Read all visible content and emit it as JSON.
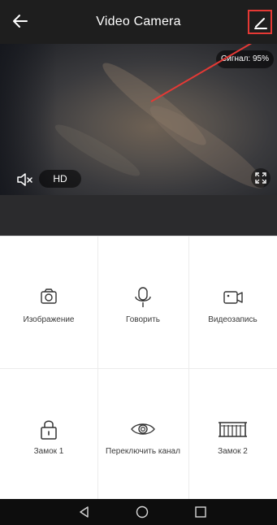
{
  "header": {
    "title": "Video Camera",
    "back_icon": "arrow-left-icon",
    "edit_icon": "pencil-icon"
  },
  "video": {
    "signal_label": "Сигнал: 95%",
    "quality_label": "HD",
    "mute_icon": "speaker-muted-icon",
    "fullscreen_icon": "fullscreen-icon"
  },
  "actions": [
    {
      "label": "Изображение",
      "icon": "camera-icon"
    },
    {
      "label": "Говорить",
      "icon": "microphone-icon"
    },
    {
      "label": "Видеозапись",
      "icon": "video-record-icon"
    },
    {
      "label": "Замок 1",
      "icon": "lock-icon"
    },
    {
      "label": "Переключить канал",
      "icon": "eye-icon"
    },
    {
      "label": "Замок 2",
      "icon": "gate-icon"
    }
  ],
  "navigation": {
    "back": "triangle-back-icon",
    "home": "circle-home-icon",
    "recents": "square-recents-icon"
  },
  "colors": {
    "header_bg": "#1e1e1e",
    "annotation_red": "#e53935",
    "band_bg": "#2b2b2d",
    "navbar_bg": "#0d0d0d"
  }
}
